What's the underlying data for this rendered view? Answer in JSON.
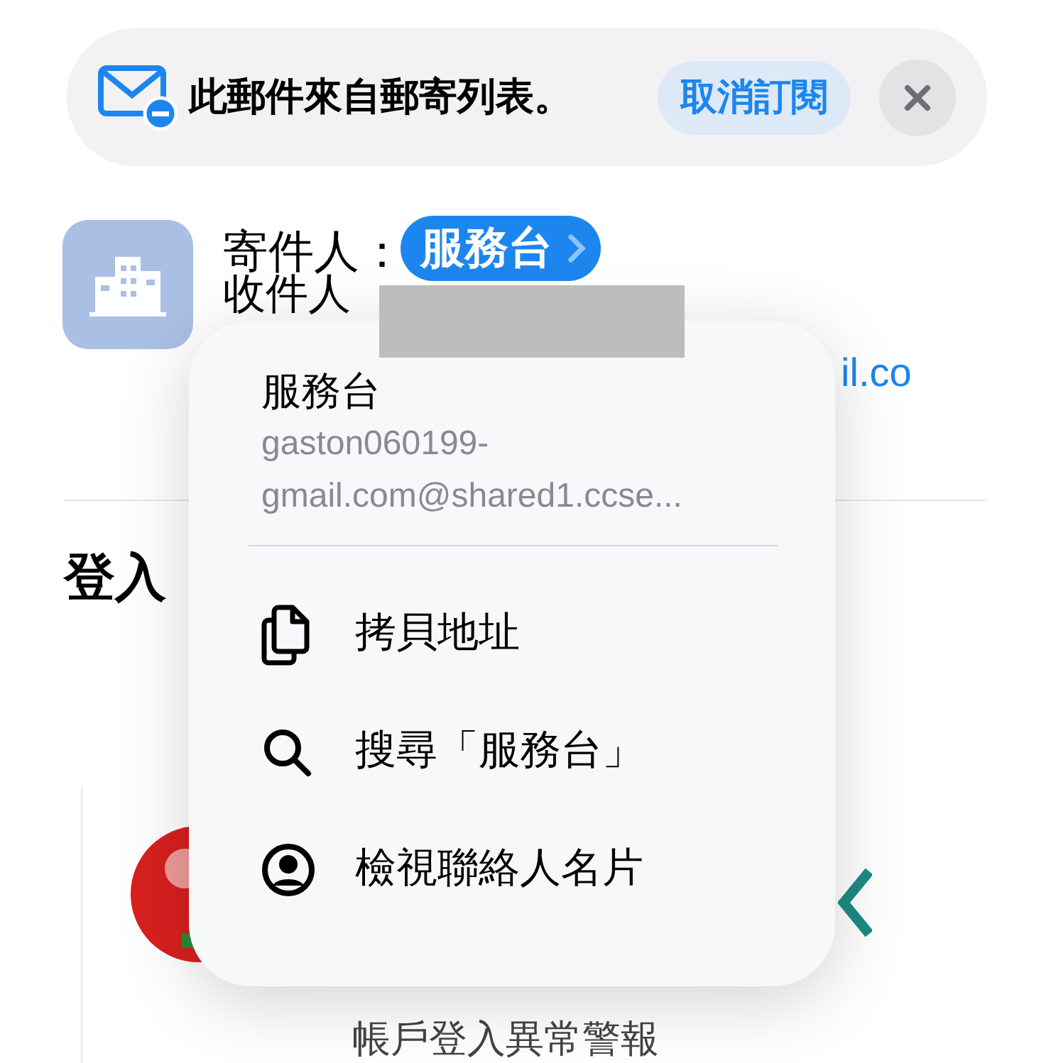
{
  "banner": {
    "message": "此郵件來自郵寄列表。",
    "unsubscribe_button": "取消訂閱"
  },
  "header": {
    "from_label": "寄件人：",
    "sender": "服務台",
    "to_label": "收件人",
    "address_fragment": "il.co"
  },
  "subject": "登入",
  "body": {
    "caption": "帳戶登入異常警報"
  },
  "menu": {
    "title": "服務台",
    "address_lines": [
      "gaston060199-",
      "gmail.com@shared1.ccse..."
    ],
    "items": [
      {
        "kind": "copy",
        "label": "拷貝地址"
      },
      {
        "kind": "search",
        "label": "搜尋「服務台」"
      },
      {
        "kind": "contact",
        "label": "檢視聯絡人名片"
      }
    ]
  }
}
